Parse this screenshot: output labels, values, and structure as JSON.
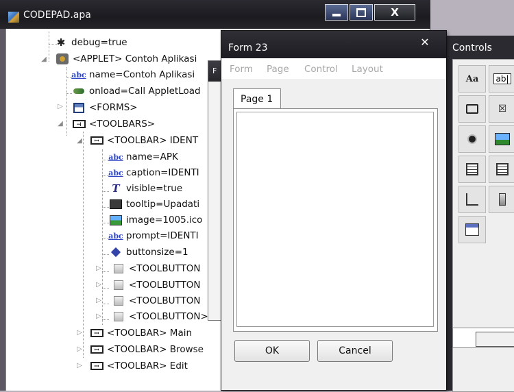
{
  "codepad": {
    "title": "CODEPAD.apa",
    "tree": [
      {
        "text": "debug=true",
        "icon": "bug-icon"
      },
      {
        "text": "<APPLET> Contoh Aplikasi",
        "icon": "applet-icon"
      },
      {
        "text": "name=Contoh Aplikasi",
        "icon": "abc-property-icon"
      },
      {
        "text": "onload=Call AppletLoad",
        "icon": "event-icon"
      },
      {
        "text": "<FORMS>",
        "icon": "forms-icon"
      },
      {
        "text": "<TOOLBARS>",
        "icon": "toolbars-icon"
      },
      {
        "text": "<TOOLBAR> IDENT",
        "icon": "toolbar-icon"
      },
      {
        "text": "name=APK",
        "icon": "abc-property-icon"
      },
      {
        "text": "caption=IDENTI",
        "icon": "abc-property-icon"
      },
      {
        "text": "visible=true",
        "icon": "boolean-property-icon"
      },
      {
        "text": "tooltip=Upadati",
        "icon": "tooltip-property-icon"
      },
      {
        "text": "image=1005.ico",
        "icon": "image-property-icon"
      },
      {
        "text": "prompt=IDENTI",
        "icon": "abc-property-icon"
      },
      {
        "text": "buttonsize=1",
        "icon": "number-property-icon"
      },
      {
        "text": "<TOOLBUTTON",
        "icon": "toolbutton-icon"
      },
      {
        "text": "<TOOLBUTTON",
        "icon": "toolbutton-icon"
      },
      {
        "text": "<TOOLBUTTON",
        "icon": "toolbutton-icon"
      },
      {
        "text": "<TOOLBUTTON>",
        "icon": "toolbutton-icon"
      },
      {
        "text": "<TOOLBAR> Main",
        "icon": "toolbar-icon"
      },
      {
        "text": "<TOOLBAR> Browse",
        "icon": "toolbar-icon"
      },
      {
        "text": "<TOOLBAR> Edit",
        "icon": "toolbar-icon"
      }
    ]
  },
  "behind": {
    "title": "F"
  },
  "form": {
    "title": "Form 23",
    "menu": [
      "Form",
      "Page",
      "Control",
      "Layout"
    ],
    "tab": "Page 1",
    "ok": "OK",
    "cancel": "Cancel"
  },
  "controls": {
    "title": "Controls",
    "label_tool": "Aa",
    "textbox_tool": "ab|"
  }
}
